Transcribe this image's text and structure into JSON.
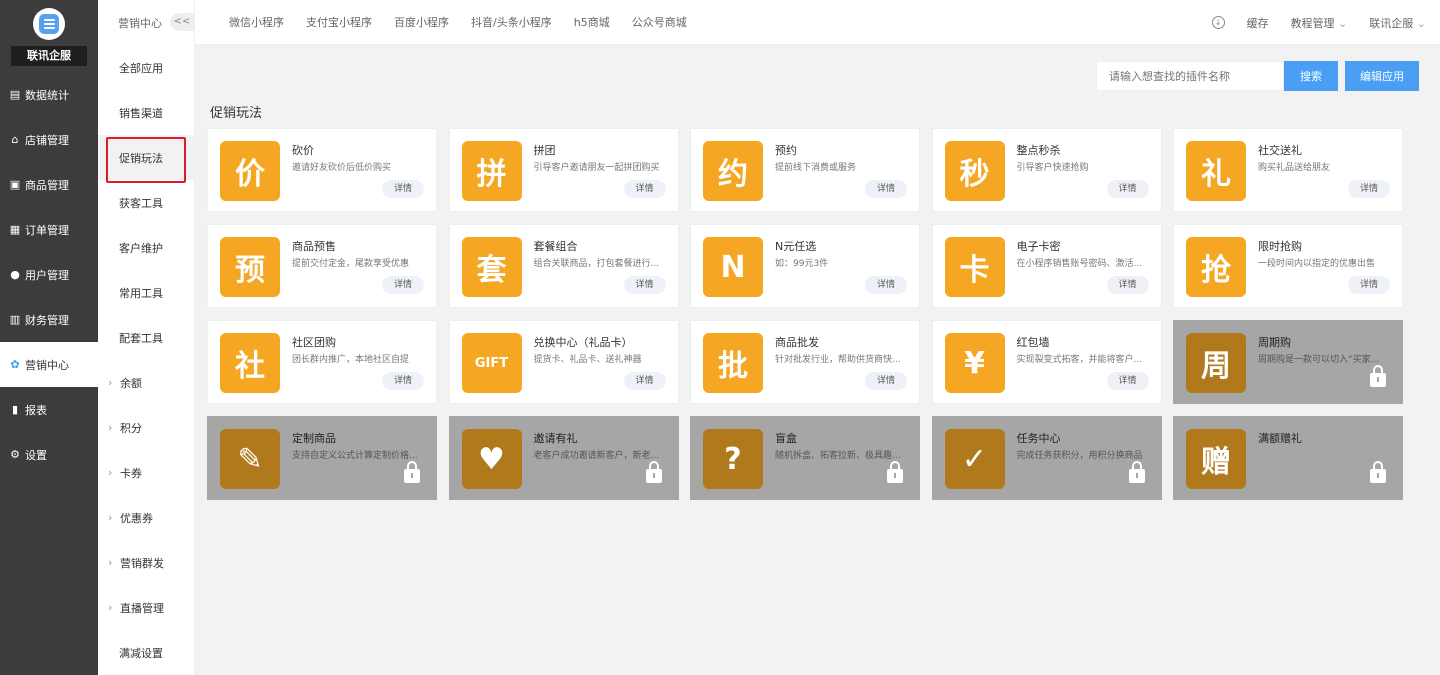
{
  "brand": {
    "name": "联讯企服"
  },
  "sidebar": {
    "items": [
      {
        "label": "数据统计",
        "icon": "chart-icon"
      },
      {
        "label": "店铺管理",
        "icon": "store-icon"
      },
      {
        "label": "商品管理",
        "icon": "goods-icon"
      },
      {
        "label": "订单管理",
        "icon": "order-icon"
      },
      {
        "label": "用户管理",
        "icon": "user-icon"
      },
      {
        "label": "财务管理",
        "icon": "finance-icon"
      },
      {
        "label": "营销中心",
        "icon": "marketing-icon",
        "active": true
      },
      {
        "label": "报表",
        "icon": "report-icon"
      },
      {
        "label": "设置",
        "icon": "settings-icon"
      }
    ]
  },
  "subnav": {
    "title": "营销中心",
    "collapse_label": "<<",
    "items": [
      {
        "label": "全部应用",
        "arrow": false
      },
      {
        "label": "销售渠道",
        "arrow": false
      },
      {
        "label": "促销玩法",
        "arrow": false,
        "active": true
      },
      {
        "label": "获客工具",
        "arrow": false
      },
      {
        "label": "客户维护",
        "arrow": false
      },
      {
        "label": "常用工具",
        "arrow": false
      },
      {
        "label": "配套工具",
        "arrow": false
      },
      {
        "label": "余额",
        "arrow": true
      },
      {
        "label": "积分",
        "arrow": true
      },
      {
        "label": "卡券",
        "arrow": true
      },
      {
        "label": "优惠券",
        "arrow": true
      },
      {
        "label": "营销群发",
        "arrow": true
      },
      {
        "label": "直播管理",
        "arrow": true
      },
      {
        "label": "满减设置",
        "arrow": false
      }
    ]
  },
  "topbar": {
    "tabs": [
      "微信小程序",
      "支付宝小程序",
      "百度小程序",
      "抖音/头条小程序",
      "h5商城",
      "公众号商城"
    ],
    "cache_label": "缓存",
    "tutorial_label": "教程管理",
    "account_label": "联讯企服",
    "download_glyph": "↓",
    "dropdown_glyph": "⌄"
  },
  "search": {
    "placeholder": "请输入想查找的插件名称",
    "button_label": "搜索",
    "edit_label": "编辑应用"
  },
  "section": {
    "title": "促销玩法"
  },
  "detail_label": "详情",
  "colors": {
    "accent": "#4a9ff5",
    "card_icon": "#f5a623",
    "sidebar": "#3c3c3c",
    "locked": "#a6a6a6"
  },
  "plugins": [
    {
      "name": "砍价",
      "desc": "邀请好友砍价后低价购买",
      "glyph": "价",
      "locked": false
    },
    {
      "name": "拼团",
      "desc": "引导客户邀请朋友一起拼团购买",
      "glyph": "拼",
      "locked": false
    },
    {
      "name": "预约",
      "desc": "提前线下消费或服务",
      "glyph": "约",
      "locked": false
    },
    {
      "name": "整点秒杀",
      "desc": "引导客户快速抢购",
      "glyph": "秒",
      "locked": false
    },
    {
      "name": "社交送礼",
      "desc": "购买礼品送给朋友",
      "glyph": "礼",
      "locked": false
    },
    {
      "name": "商品预售",
      "desc": "提前交付定金，尾款享受优惠",
      "glyph": "预",
      "locked": false
    },
    {
      "name": "套餐组合",
      "desc": "组合关联商品，打包套餐进行...",
      "glyph": "套",
      "locked": false
    },
    {
      "name": "N元任选",
      "desc": "如：99元3件",
      "glyph": "N",
      "locked": false
    },
    {
      "name": "电子卡密",
      "desc": "在小程序销售账号密码、激活...",
      "glyph": "卡",
      "locked": false
    },
    {
      "name": "限时抢购",
      "desc": "一段时间内以指定的优惠出售",
      "glyph": "抢",
      "locked": false
    },
    {
      "name": "社区团购",
      "desc": "团长群内推广，本地社区自提",
      "glyph": "社",
      "locked": false
    },
    {
      "name": "兑换中心（礼品卡）",
      "desc": "提货卡、礼品卡、送礼神器",
      "glyph": "GIFT",
      "locked": false
    },
    {
      "name": "商品批发",
      "desc": "针对批发行业，帮助供货商快...",
      "glyph": "批",
      "locked": false
    },
    {
      "name": "红包墙",
      "desc": "实现裂变式拓客，并能将客户...",
      "glyph": "¥",
      "locked": false
    },
    {
      "name": "周期购",
      "desc": "周期购是一款可以切入“买家...",
      "glyph": "周",
      "locked": true
    },
    {
      "name": "定制商品",
      "desc": "支持自定义公式计算定制价格...",
      "glyph": "✎",
      "locked": true
    },
    {
      "name": "邀请有礼",
      "desc": "老客户成功邀请新客户，新老...",
      "glyph": "♥",
      "locked": true
    },
    {
      "name": "盲盒",
      "desc": "随机拆盒、拓客拉新、极具趣...",
      "glyph": "?",
      "locked": true
    },
    {
      "name": "任务中心",
      "desc": "完成任务获积分，用积分换商品",
      "glyph": "✓",
      "locked": true
    },
    {
      "name": "满额赠礼",
      "desc": "",
      "glyph": "赠",
      "locked": true
    }
  ]
}
